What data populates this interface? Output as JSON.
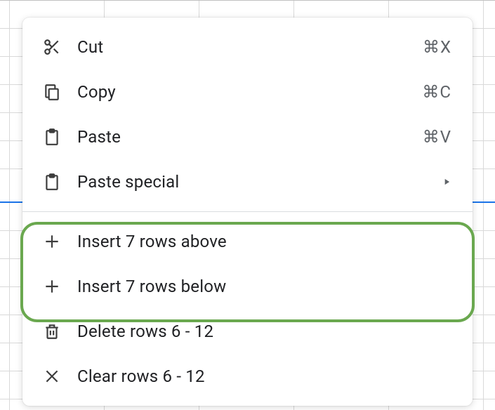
{
  "menu": {
    "cut": {
      "label": "Cut",
      "shortcut": "⌘X"
    },
    "copy": {
      "label": "Copy",
      "shortcut": "⌘C"
    },
    "paste": {
      "label": "Paste",
      "shortcut": "⌘V"
    },
    "paste_special": {
      "label": "Paste special"
    },
    "insert_above": {
      "label": "Insert 7 rows above"
    },
    "insert_below": {
      "label": "Insert 7 rows below"
    },
    "delete": {
      "label": "Delete rows 6 - 12"
    },
    "clear": {
      "label": "Clear rows 6 - 12"
    }
  }
}
